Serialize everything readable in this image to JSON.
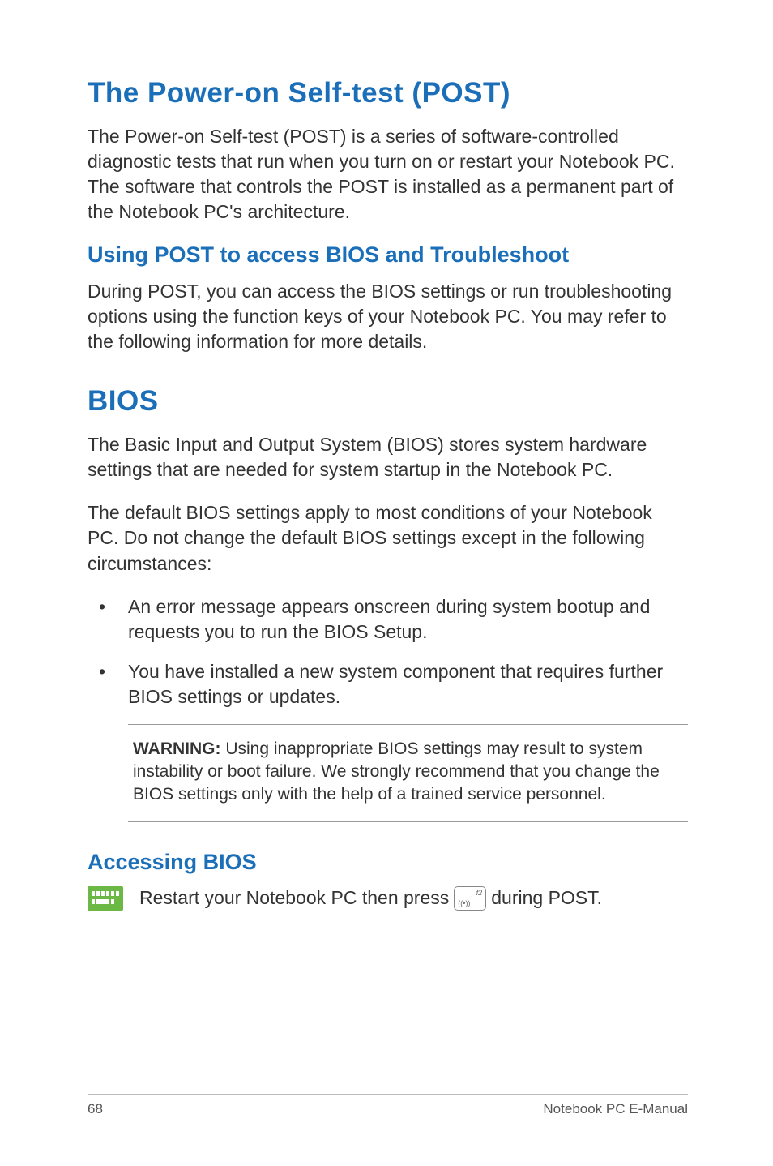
{
  "heading1": "The Power-on Self-test (POST)",
  "para1": "The Power-on Self-test (POST)  is a series of software-controlled diagnostic tests that run when you turn on or restart your Notebook PC. The software that controls the POST is installed as a permanent part of the Notebook PC's architecture.",
  "heading2": "Using POST to access BIOS and Troubleshoot",
  "para2": "During POST, you can access the BIOS settings or run troubleshooting options using the function keys of your Notebook PC. You may refer to the following information for more details.",
  "heading3": "BIOS",
  "para3": "The Basic Input and Output System (BIOS) stores system hardware settings that are needed for system startup in the Notebook PC.",
  "para4": "The default BIOS settings apply to most conditions of your Notebook PC. Do not change the default BIOS settings except in the following circumstances:",
  "bullets": [
    "An error message appears onscreen during system bootup and requests you to run the BIOS Setup.",
    "You have installed a new system component that requires further BIOS settings or updates."
  ],
  "warning_label": "WARNING:",
  "warning_text": " Using inappropriate BIOS settings may result to system instability or boot failure. We strongly recommend that you change the BIOS settings only with the help of a trained service personnel.",
  "heading4": "Accessing BIOS",
  "access_pre": "Restart your Notebook PC then press ",
  "access_post": " during POST.",
  "key_label": "f2",
  "key_icon_glyph": "((•))",
  "footer_page": "68",
  "footer_title": "Notebook PC E-Manual"
}
